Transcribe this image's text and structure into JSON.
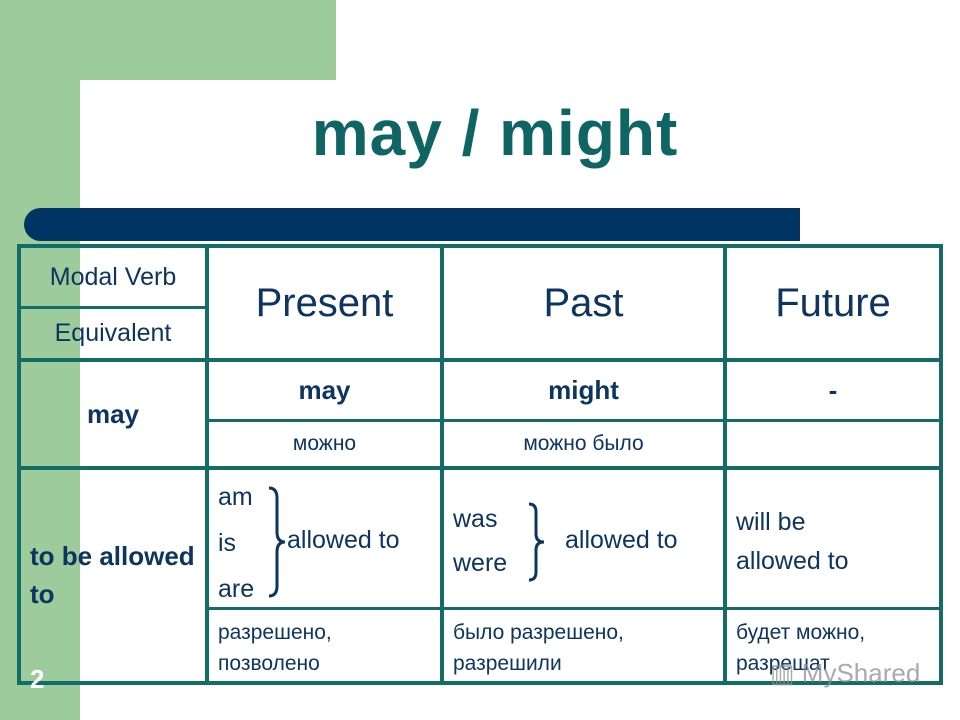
{
  "slide": {
    "title": "may / might",
    "page_number": "2",
    "watermark": "MyShared"
  },
  "table": {
    "header": {
      "modal_verb": "Modal Verb",
      "equivalent": "Equivalent",
      "columns": [
        "Present",
        "Past",
        "Future"
      ]
    },
    "rows": [
      {
        "label": "may",
        "forms": [
          "may",
          "might",
          "-"
        ],
        "translations": [
          "можно",
          "можно было",
          ""
        ]
      },
      {
        "label": "to be allowed to",
        "present": {
          "verbs": [
            "am",
            "is",
            "are"
          ],
          "phrase": "allowed to"
        },
        "past": {
          "verbs": [
            "was",
            "were"
          ],
          "phrase": "allowed to"
        },
        "future": {
          "line1": "will be",
          "line2": "allowed to"
        },
        "translations": [
          {
            "line1": "разрешено,",
            "line2": "позволено"
          },
          {
            "line1": "было разрешено,",
            "line2": "разрешили"
          },
          {
            "line1": "будет можно,",
            "line2": "разрешат"
          }
        ]
      }
    ]
  },
  "colors": {
    "green": "#9dcb9b",
    "title": "#0e6563",
    "bar": "#003463",
    "grid": "#136d66",
    "text": "#0d3560"
  }
}
